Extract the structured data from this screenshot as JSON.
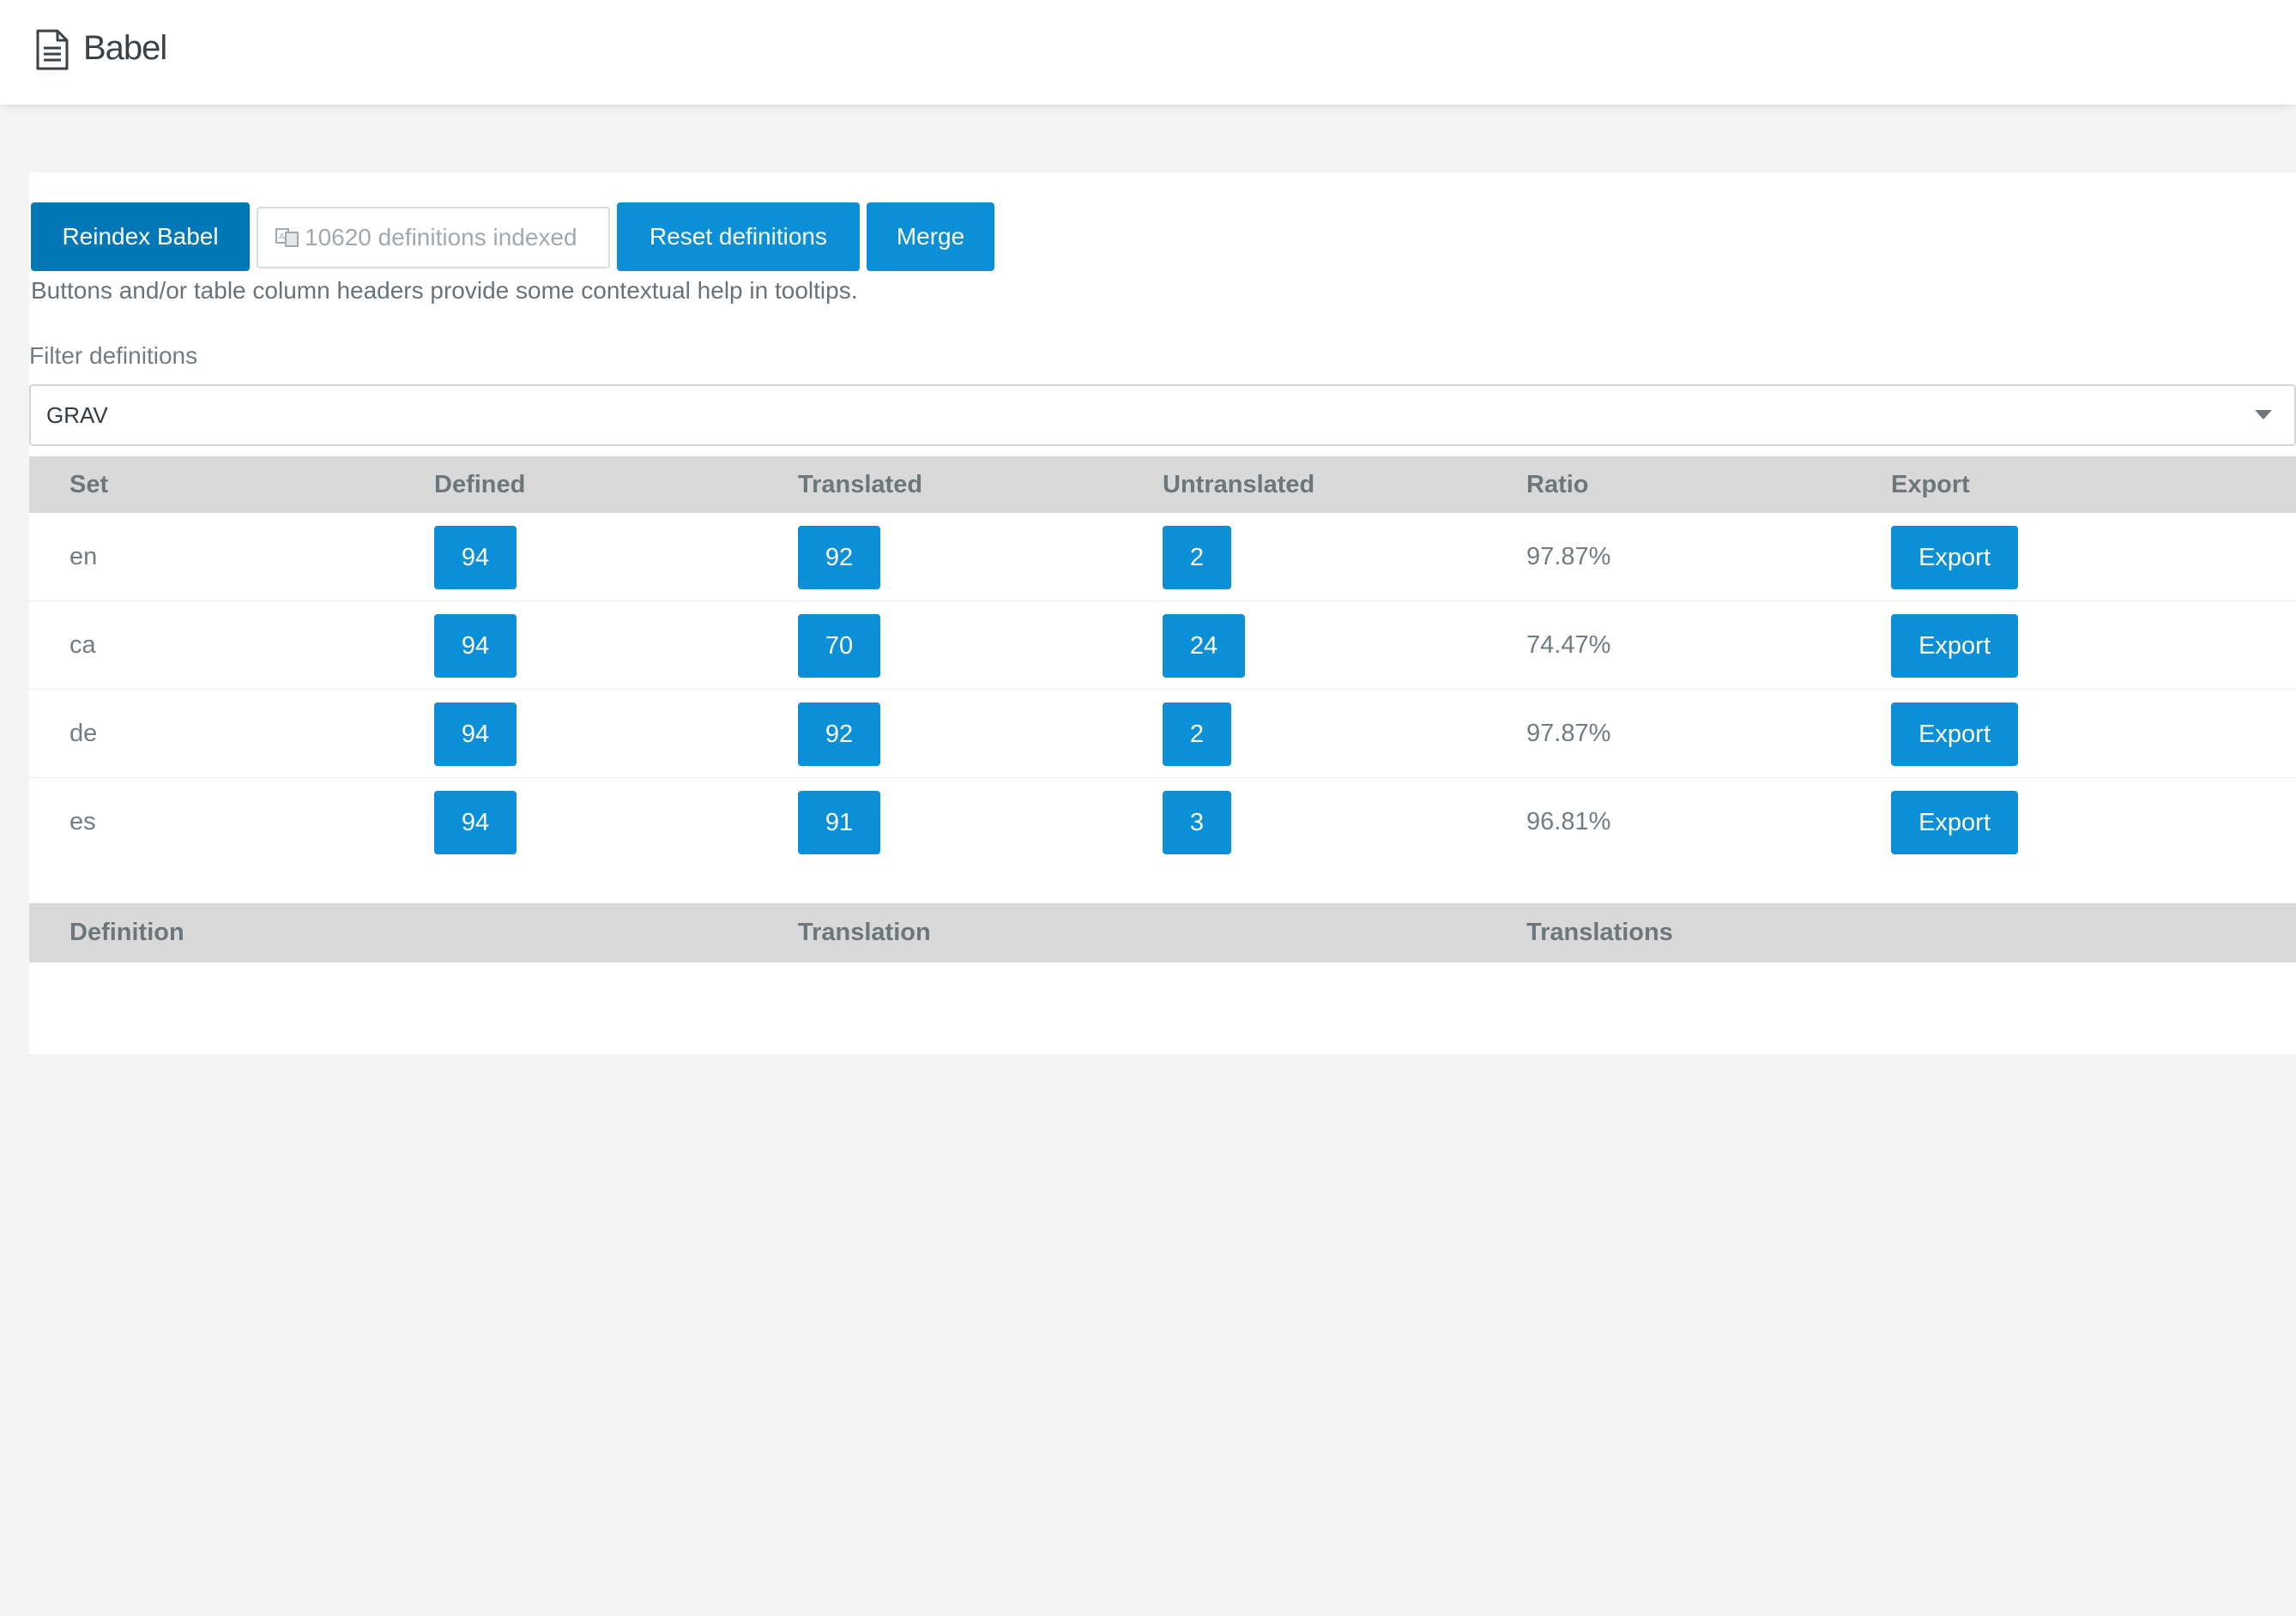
{
  "header": {
    "title": "Babel",
    "icon": "document-icon"
  },
  "toolbar": {
    "reindex_label": "Reindex Babel",
    "indexed_count_text": "10620 definitions indexed",
    "indexed_icon": "language-icon",
    "reset_label": "Reset definitions",
    "merge_label": "Merge",
    "help_text": "Buttons and/or table column headers provide some contextual help in tooltips."
  },
  "filter": {
    "label": "Filter definitions",
    "selected": "GRAV"
  },
  "sets_table": {
    "headers": [
      "Set",
      "Defined",
      "Translated",
      "Untranslated",
      "Ratio",
      "Export"
    ],
    "rows": [
      {
        "set": "en",
        "defined": "94",
        "translated": "92",
        "untranslated": "2",
        "ratio": "97.87%",
        "export": "Export"
      },
      {
        "set": "ca",
        "defined": "94",
        "translated": "70",
        "untranslated": "24",
        "ratio": "74.47%",
        "export": "Export"
      },
      {
        "set": "de",
        "defined": "94",
        "translated": "92",
        "untranslated": "2",
        "ratio": "97.87%",
        "export": "Export"
      },
      {
        "set": "es",
        "defined": "94",
        "translated": "91",
        "untranslated": "3",
        "ratio": "96.81%",
        "export": "Export"
      }
    ]
  },
  "definitions_table": {
    "headers": [
      "Definition",
      "Translation",
      "Translations"
    ]
  },
  "colors": {
    "accent": "#0b8fd6",
    "accent_dark": "#0477b6",
    "header_bg": "#d9d9d9",
    "page_bg": "#f4f4f4"
  }
}
